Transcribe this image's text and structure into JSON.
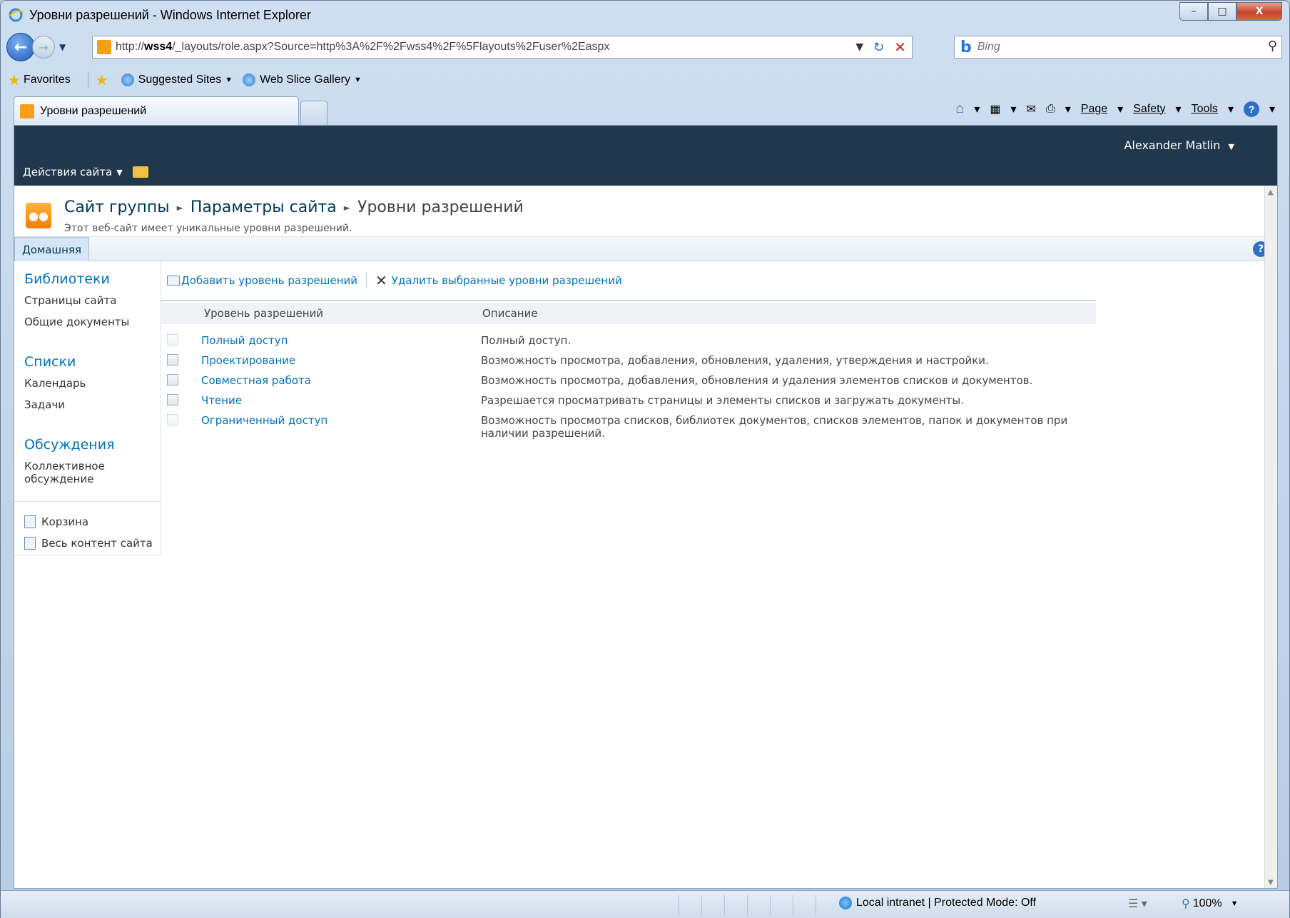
{
  "window": {
    "title": "Уровни разрешений - Windows Internet Explorer",
    "controls": {
      "minimize": "–",
      "maximize": "□",
      "close": "X"
    }
  },
  "address_bar": {
    "url_prefix": "http://",
    "url_host": "wss4",
    "url_path": "/_layouts/role.aspx?Source=http%3A%2F%2Fwss4%2F%5Flayouts%2Fuser%2Easpx",
    "search_placeholder": "Bing"
  },
  "favorites_bar": {
    "favorites_label": "Favorites",
    "items": [
      {
        "label": "Suggested Sites"
      },
      {
        "label": "Web Slice Gallery"
      }
    ]
  },
  "tabs": [
    {
      "label": "Уровни разрешений"
    }
  ],
  "command_bar": {
    "page": "Page",
    "safety": "Safety",
    "tools": "Tools"
  },
  "sharepoint": {
    "site_actions": "Действия сайта",
    "user": "Alexander Matlin",
    "breadcrumb": [
      "Сайт группы",
      "Параметры сайта",
      "Уровни разрешений"
    ],
    "subtitle": "Этот веб-сайт имеет уникальные уровни разрешений.",
    "home_tab": "Домашняя",
    "quick_launch": {
      "libraries": {
        "heading": "Библиотеки",
        "items": [
          "Страницы сайта",
          "Общие документы"
        ]
      },
      "lists": {
        "heading": "Списки",
        "items": [
          "Календарь",
          "Задачи"
        ]
      },
      "discussions": {
        "heading": "Обсуждения",
        "items": [
          "Коллективное обсуждение"
        ]
      },
      "recycle_bin": "Корзина",
      "all_content": "Весь контент сайта"
    },
    "toolbar": {
      "add": "Добавить уровень разрешений",
      "delete": "Удалить выбранные уровни разрешений"
    },
    "list": {
      "columns": [
        "Уровень разрешений",
        "Описание"
      ],
      "rows": [
        {
          "name": "Полный доступ",
          "description": "Полный доступ.",
          "selectable": false
        },
        {
          "name": "Проектирование",
          "description": "Возможность просмотра, добавления, обновления, удаления, утверждения и настройки.",
          "selectable": true
        },
        {
          "name": "Совместная работа",
          "description": "Возможность просмотра, добавления, обновления и удаления элементов списков и документов.",
          "selectable": true
        },
        {
          "name": "Чтение",
          "description": "Разрешается просматривать страницы и элементы списков и загружать документы.",
          "selectable": true
        },
        {
          "name": "Ограниченный доступ",
          "description": "Возможность просмотра списков, библиотек документов, списков элементов, папок и документов при наличии разрешений.",
          "selectable": false
        }
      ]
    }
  },
  "status_bar": {
    "zone": "Local intranet | Protected Mode: Off",
    "zoom": "100%"
  }
}
